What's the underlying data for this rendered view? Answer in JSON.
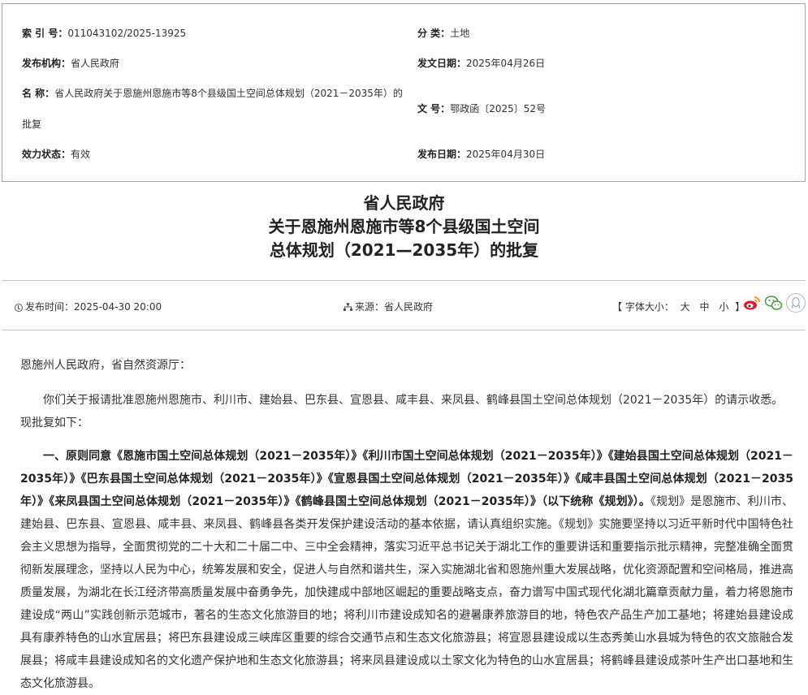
{
  "meta": {
    "index_label": "索 引 号：",
    "index_value": "011043102/2025-13925",
    "category_label": "分 类：",
    "category_value": "土地",
    "publisher_label": "发布机构：",
    "publisher_value": "省人民政府",
    "issue_date_label": "发文日期：",
    "issue_date_value": "2025年04月26日",
    "name_label": "名 称：",
    "name_value_line1": "省人民政府关于恩施州恩施市等8个县级国土空间总体规划（2021－2035年）的",
    "name_value_line2": "批复",
    "docno_label": "文 号：",
    "docno_value": "鄂政函〔2025〕52号",
    "status_label": "效力状态：",
    "status_value": "有效",
    "release_date_label": "发布日期：",
    "release_date_value": "2025年04月30日"
  },
  "title": {
    "line1": "省人民政府",
    "line2": "关于恩施州恩施市等8个县级国土空间",
    "line3": "总体规划（2021—2035年）的批复"
  },
  "info": {
    "pubtime": "发布时间：2025-04-30 20:00",
    "source": "来源：省人民政府",
    "fontsize_open": "【 字体大小：",
    "fontsize_big": "大",
    "fontsize_mid": "中",
    "fontsize_small": "小",
    "fontsize_close": "】"
  },
  "icons": {
    "clock": "clock-icon",
    "sitemap": "sitemap-icon",
    "weibo": "weibo-icon",
    "wechat": "wechat-icon",
    "qq": "qq-icon"
  },
  "content": {
    "salutation": "恩施州人民政府，省自然资源厅：",
    "intro": "你们关于报请批准恩施州恩施市、利川市、建始县、巴东县、宣恩县、咸丰县、来凤县、鹤峰县国土空间总体规划（2021－2035年）的请示收悉。现批复如下：",
    "main_bold": "一、原则同意《恩施市国土空间总体规划（2021－2035年）》《利川市国土空间总体规划（2021－2035年）》《建始县国土空间总体规划（2021－2035年）》《巴东县国土空间总体规划（2021－2035年）》《宣恩县国土空间总体规划（2021－2035年）》《咸丰县国土空间总体规划（2021－2035年）》《来凤县国土空间总体规划（2021－2035年）》《鹤峰县国土空间总体规划（2021－2035年）》（以下统称《规划》）。",
    "main_rest": "《规划》是恩施市、利川市、建始县、巴东县、宣恩县、咸丰县、来凤县、鹤峰县各类开发保护建设活动的基本依据，请认真组织实施。《规划》实施要坚持以习近平新时代中国特色社会主义思想为指导，全面贯彻党的二十大和二十届二中、三中全会精神，落实习近平总书记关于湖北工作的重要讲话和重要指示批示精神，完整准确全面贯彻新发展理念，坚持以人民为中心，统筹发展和安全，促进人与自然和谐共生，深入实施湖北省和恩施州重大发展战略，优化资源配置和空间格局，推进高质量发展，为湖北在长江经济带高质量发展中奋勇争先，加快建成中部地区崛起的重要战略支点，奋力谱写中国式现代化湖北篇章贡献力量，着力将恩施市建设成“两山”实践创新示范城市，著名的生态文化旅游目的地；将利川市建设成知名的避暑康养旅游目的地，特色农产品生产加工基地；将建始县建设成具有康养特色的山水宜居县；将巴东县建设成三峡库区重要的综合交通节点和生态文化旅游县；将宣恩县建设成以生态秀美山水县城为特色的农文旅融合发展县；将咸丰县建设成知名的文化遗产保护地和生态文化旅游县；将来凤县建设成以土家文化为特色的山水宜居县；将鹤峰县建设成茶叶生产出口基地和生态文化旅游县。"
  }
}
